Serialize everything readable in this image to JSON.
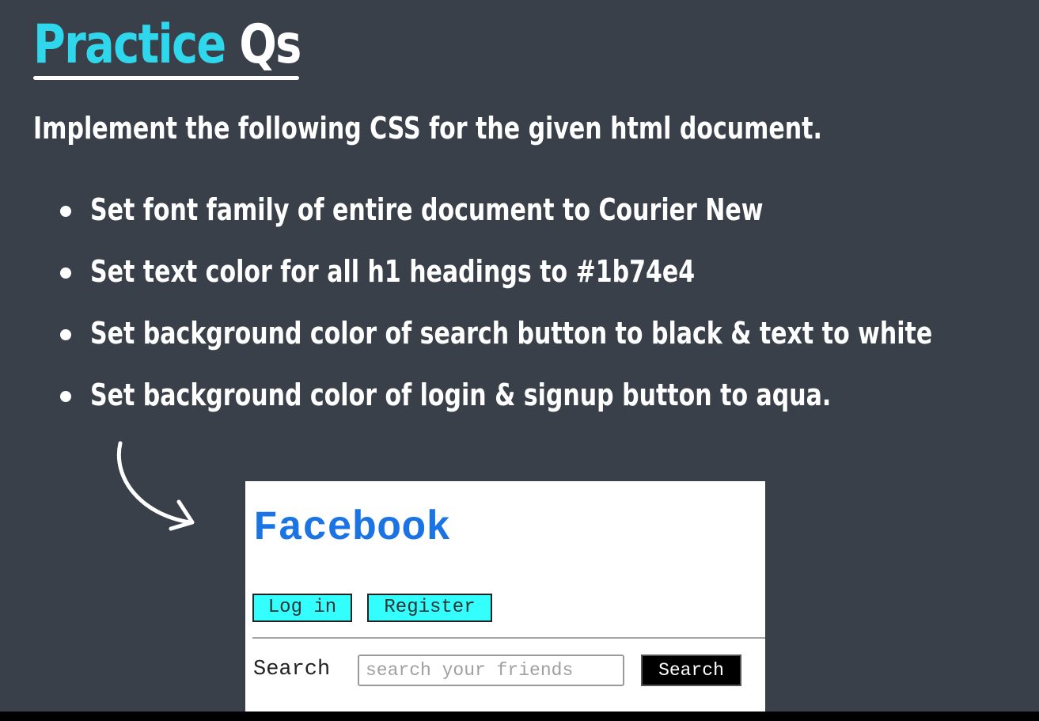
{
  "slide": {
    "title_accent": "Practice",
    "title_rest": "Qs",
    "instruction": "Implement the following CSS for the given html document.",
    "bullets": [
      "Set font family of entire document to Courier New",
      "Set text color for all h1 headings to #1b74e4",
      "Set background color of search button to black & text to white",
      "Set background color of login & signup button to aqua."
    ]
  },
  "demo": {
    "heading": "Facebook",
    "login_label": "Log in",
    "register_label": "Register",
    "search_label": "Search",
    "search_placeholder": "search your friends",
    "search_button_label": "Search"
  },
  "colors": {
    "background": "#3a4049",
    "title_accent": "#2fd7ec",
    "heading": "#1b74e4",
    "aqua": "#33ffff",
    "search_button_bg": "#000000"
  }
}
